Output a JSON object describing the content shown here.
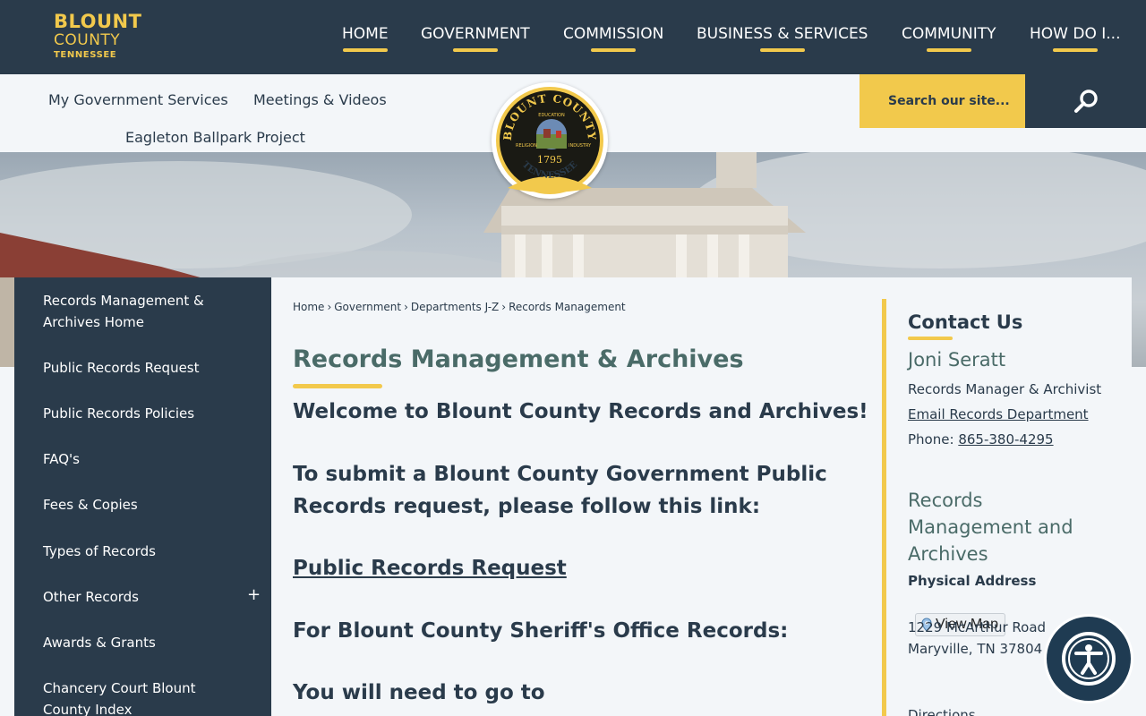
{
  "header": {
    "logo": {
      "line1": "BLOUNT",
      "line2": "COUNTY",
      "line3": "TENNESSEE"
    },
    "nav": [
      "HOME",
      "GOVERNMENT",
      "COMMISSION",
      "BUSINESS & SERVICES",
      "COMMUNITY",
      "HOW DO I..."
    ]
  },
  "subnav": {
    "links": [
      "My Government Services",
      "Meetings & Videos",
      "Eagleton Ballpark Project"
    ],
    "search_placeholder": "Search our site...",
    "seal": {
      "top": "BLOUNT COUNTY",
      "education": "EDUCATION",
      "religion": "RELIGION",
      "industry": "INDUSTRY",
      "year": "1795",
      "bottom": "TENNESSEE"
    }
  },
  "icons": {
    "facebook": "facebook-icon",
    "youtube": "youtube-icon",
    "search": "search-icon",
    "accessibility": "accessibility-icon",
    "map_pin": "map-pin-icon"
  },
  "colors": {
    "navy": "#2a3b4b",
    "gold": "#f2c94c",
    "teal": "#4a6b68",
    "facebook": "#1877f2",
    "youtube": "#ff0000"
  },
  "sidebar": {
    "items": [
      "Records Management & Archives Home",
      "Public Records Request",
      "Public Records Policies",
      "FAQ's",
      "Fees & Copies",
      "Types of Records",
      "Other Records",
      "Awards & Grants",
      "Chancery Court Blount County Index"
    ],
    "expand": "+"
  },
  "breadcrumb": [
    "Home",
    "Government",
    "Departments J-Z",
    "Records Management"
  ],
  "breadcrumb_sep": "›",
  "main": {
    "title": "Records Management & Archives",
    "welcome": "Welcome to Blount County Records and Archives!",
    "submit_text": "To submit a Blount County Government Public Records request, please follow this link:",
    "request_link": "Public Records Request",
    "sheriff_text": "For Blount County Sheriff's Office Records:",
    "go_text": "You will need to go to"
  },
  "contact": {
    "heading": "Contact Us",
    "name": "Joni Seratt",
    "role": "Records Manager & Archivist",
    "email_label": "Email Records Department",
    "phone_label": "Phone:",
    "phone": "865-380-4295",
    "dept_heading": "Records Management and Archives",
    "address_label": "Physical Address",
    "map_button": "View Map",
    "address_line1": "1229 McArthur Road",
    "address_line2": "Maryville, TN 37804",
    "directions": "Directions"
  }
}
